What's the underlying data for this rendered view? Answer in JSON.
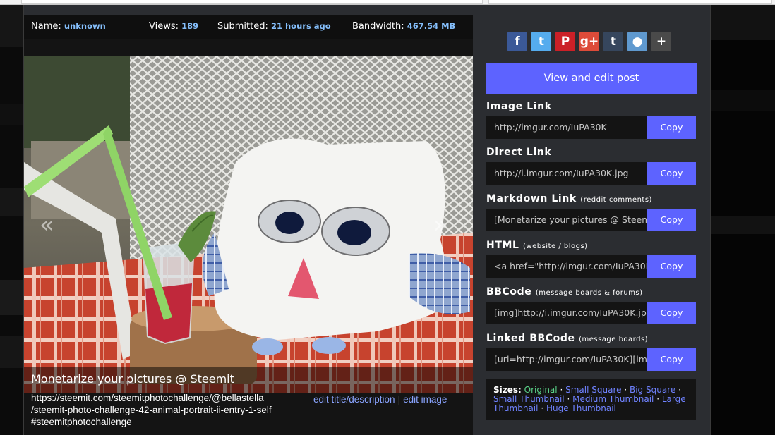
{
  "stats": {
    "name_label": "Name:",
    "name_value": "unknown",
    "views_label": "Views:",
    "views_value": "189",
    "submitted_label": "Submitted:",
    "submitted_value": "21 hours ago",
    "bandwidth_label": "Bandwidth:",
    "bandwidth_value": "467.54 MB"
  },
  "image": {
    "prev_glyph": "«",
    "next_glyph": "»",
    "caption": "Monetarize your pictures @ Steemit",
    "description": "https://steemit.com/steemitphotochallenge/@bellastella/steemit-photo-challenge-42-animal-portrait-ii-entry-1-self #steemitphotochallenge",
    "desc_lines": [
      "https://steemit.com/steemitphotochallenge/@bellastella",
      "/steemit-photo-challenge-42-animal-portrait-ii-entry-1-self",
      "#steemitphotochallenge"
    ],
    "edit_title_label": "edit title/description",
    "separator": "|",
    "edit_image_label": "edit image"
  },
  "share": {
    "buttons": [
      {
        "icon": "facebook-icon",
        "glyph": "f",
        "color": "#3b5998"
      },
      {
        "icon": "twitter-icon",
        "glyph": "t",
        "color": "#55acee"
      },
      {
        "icon": "pinterest-icon",
        "glyph": "P",
        "color": "#cb2027"
      },
      {
        "icon": "google-plus-icon",
        "glyph": "g+",
        "color": "#dd4b39"
      },
      {
        "icon": "tumblr-icon",
        "glyph": "t",
        "color": "#36465d"
      },
      {
        "icon": "reddit-icon",
        "glyph": "●",
        "color": "#5f99cf"
      },
      {
        "icon": "more-icon",
        "glyph": "+",
        "color": "#4a4a4a"
      }
    ]
  },
  "actions": {
    "view_edit_post": "View and edit post"
  },
  "links": [
    {
      "label": "Image Link",
      "sub": "",
      "value": "http://imgur.com/IuPA30K",
      "copy": "Copy"
    },
    {
      "label": "Direct Link",
      "sub": "",
      "value": "http://i.imgur.com/IuPA30K.jpg",
      "copy": "Copy"
    },
    {
      "label": "Markdown Link",
      "sub": "(reddit comments)",
      "value": "[Monetarize your pictures @ Steemit](http://imgur.com/IuPA30K)",
      "copy": "Copy"
    },
    {
      "label": "HTML",
      "sub": "(website / blogs)",
      "value": "<a href=\"http://imgur.com/IuPA30K\"><img src=\"http://i.imgur.com/IuPA30K.jpg\" /></a>",
      "copy": "Copy"
    },
    {
      "label": "BBCode",
      "sub": "(message boards & forums)",
      "value": "[img]http://i.imgur.com/IuPA30K.jpg[/img]",
      "copy": "Copy"
    },
    {
      "label": "Linked BBCode",
      "sub": "(message boards)",
      "value": "[url=http://imgur.com/IuPA30K][img]http://i.imgur.com/IuPA30K.jpg[/img][/url]",
      "copy": "Copy"
    }
  ],
  "sizes": {
    "label": "Sizes:",
    "separator": "·",
    "items": [
      "Original",
      "Small Square",
      "Big Square",
      "Small Thumbnail",
      "Medium Thumbnail",
      "Large Thumbnail",
      "Huge Thumbnail"
    ]
  }
}
